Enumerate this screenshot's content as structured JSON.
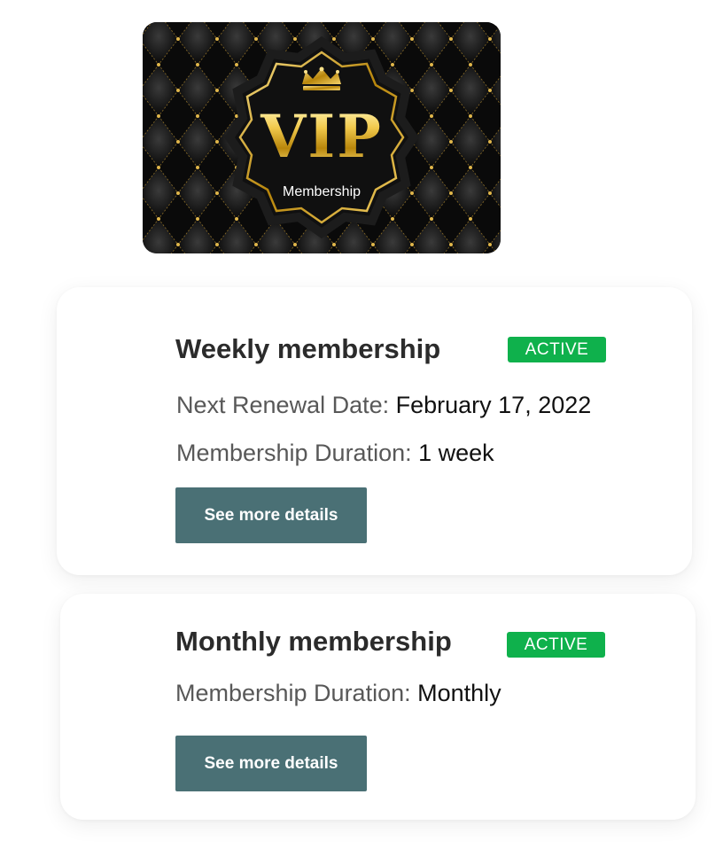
{
  "vip_card": {
    "headline": "VIP",
    "subtitle": "Membership",
    "colors": {
      "background": "#0c0c0c",
      "gold": "#d4a72c"
    }
  },
  "memberships": [
    {
      "title": "Weekly membership",
      "status": "ACTIVE",
      "next_renewal_label": "Next Renewal Date:",
      "next_renewal_value": "February 17, 2022",
      "duration_label": "Membership Duration:",
      "duration_value": "1 week",
      "button_label": "See more details"
    },
    {
      "title": "Monthly membership",
      "status": "ACTIVE",
      "duration_label": "Membership Duration:",
      "duration_value": "Monthly",
      "button_label": "See more details"
    }
  ],
  "colors": {
    "badge": "#0fb14c",
    "button": "#4a7075",
    "title_text": "#2b2b2b",
    "label_text": "#585858"
  }
}
